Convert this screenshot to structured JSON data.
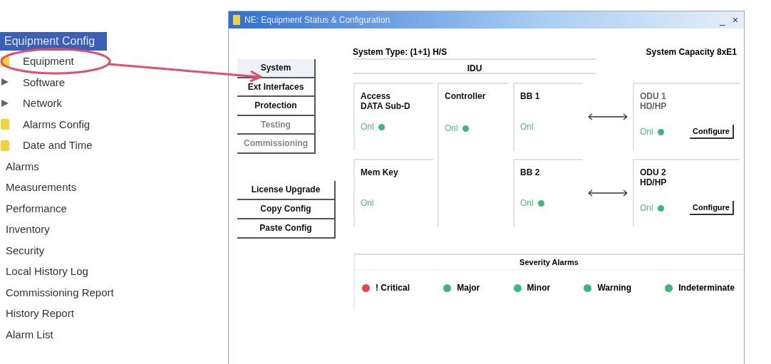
{
  "sidebar": {
    "items": [
      {
        "label": "Equipment Config",
        "selected": true,
        "children": [
          {
            "label": "Equipment",
            "kind": "folder"
          },
          {
            "label": "Software",
            "kind": "arrow"
          },
          {
            "label": "Network",
            "kind": "arrow"
          },
          {
            "label": "Alarms Config",
            "kind": "folder"
          },
          {
            "label": "Date and Time",
            "kind": "folder"
          }
        ]
      },
      {
        "label": "Alarms",
        "selected": false
      },
      {
        "label": "Measurements",
        "selected": false
      },
      {
        "label": "Performance",
        "selected": false
      },
      {
        "label": "Inventory",
        "selected": false
      },
      {
        "label": "Security",
        "selected": false
      },
      {
        "label": "Local History Log",
        "selected": false
      },
      {
        "label": "Commissioning Report",
        "selected": false
      },
      {
        "label": "History Report",
        "selected": false
      },
      {
        "label": "Alarm List",
        "selected": false
      }
    ]
  },
  "window": {
    "title": "NE: Equipment Status & Configuration",
    "minimize": "_",
    "close": "×",
    "system_type": "System Type:  (1+1) H/S",
    "system_capacity": "System Capacity  8xE1",
    "tabs": [
      {
        "label": "System",
        "selected": true,
        "disabled": false
      },
      {
        "label": "Ext Interfaces",
        "selected": false,
        "disabled": false
      },
      {
        "label": "Protection",
        "selected": false,
        "disabled": false
      },
      {
        "label": "Testing",
        "selected": false,
        "disabled": true
      },
      {
        "label": "Commissioning",
        "selected": false,
        "disabled": true
      }
    ],
    "actions": [
      "License Upgrade",
      "Copy Config",
      "Paste Config"
    ],
    "idu_label": "IDU",
    "modules": [
      {
        "name": "Access\nDATA Sub-D",
        "status": "Onl",
        "dot": true
      },
      {
        "name": "Controller",
        "status": "Onl",
        "dot": true
      },
      {
        "name": "BB 1",
        "status": "Onl",
        "dot": false
      },
      {
        "name": "Mem Key",
        "status": "Onl",
        "dot": false
      },
      {
        "name": "BB 2",
        "status": "Onl",
        "dot": true
      }
    ],
    "odus": [
      {
        "name": "ODU 1\nHD/HP",
        "status": "Onl",
        "dot": true,
        "button": "Configure"
      },
      {
        "name": "ODU 2\nHD/HP",
        "status": "Onl",
        "dot": true,
        "button": "Configure"
      }
    ],
    "alarms": {
      "title": "Severity Alarms",
      "items": [
        {
          "label": "! Critical",
          "color": "#e04a4a"
        },
        {
          "label": "Major",
          "color": "#3cb878"
        },
        {
          "label": "Minor",
          "color": "#3cb878"
        },
        {
          "label": "Warning",
          "color": "#3cb878"
        },
        {
          "label": "Indeterminate",
          "color": "#3cb878"
        }
      ]
    }
  }
}
